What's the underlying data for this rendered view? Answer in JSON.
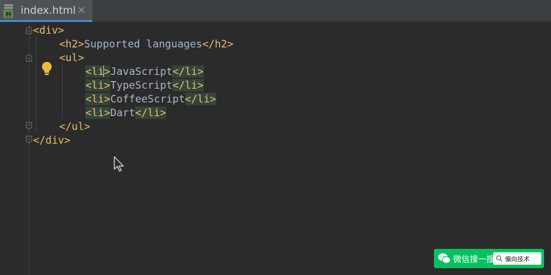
{
  "tab": {
    "file_name": "index.html",
    "close_glyph": "✕",
    "icon_badge": "H",
    "icon": "html-file-icon"
  },
  "code": {
    "lines": [
      {
        "open": "<div>"
      },
      {
        "open": "<h2>",
        "text": "Supported languages",
        "close": "</h2>"
      },
      {
        "open": "<ul>"
      },
      {
        "open_a": "<li",
        "open_b": ">",
        "text": "JavaScript",
        "close": "</li>"
      },
      {
        "open": "<li>",
        "text": "TypeScript",
        "close": "</li>"
      },
      {
        "open": "<li>",
        "text": "CoffeeScript",
        "close": "</li>"
      },
      {
        "open": "<li>",
        "text": "Dart",
        "close": "</li>"
      },
      {
        "open": "</ul>"
      },
      {
        "open": "</div>"
      }
    ]
  },
  "intention_icon": "lightbulb-icon",
  "pointer_icon": "mouse-cursor-icon",
  "watermark": {
    "label": "微信搜一搜",
    "search_text": "偏向技术",
    "icon": "wechat-icon"
  },
  "colors": {
    "background": "#2b2b2b",
    "tag": "#e8bf6a",
    "text": "#a9b7c6",
    "tab_accent": "#4a88c7",
    "watermark_green": "#07c160"
  }
}
